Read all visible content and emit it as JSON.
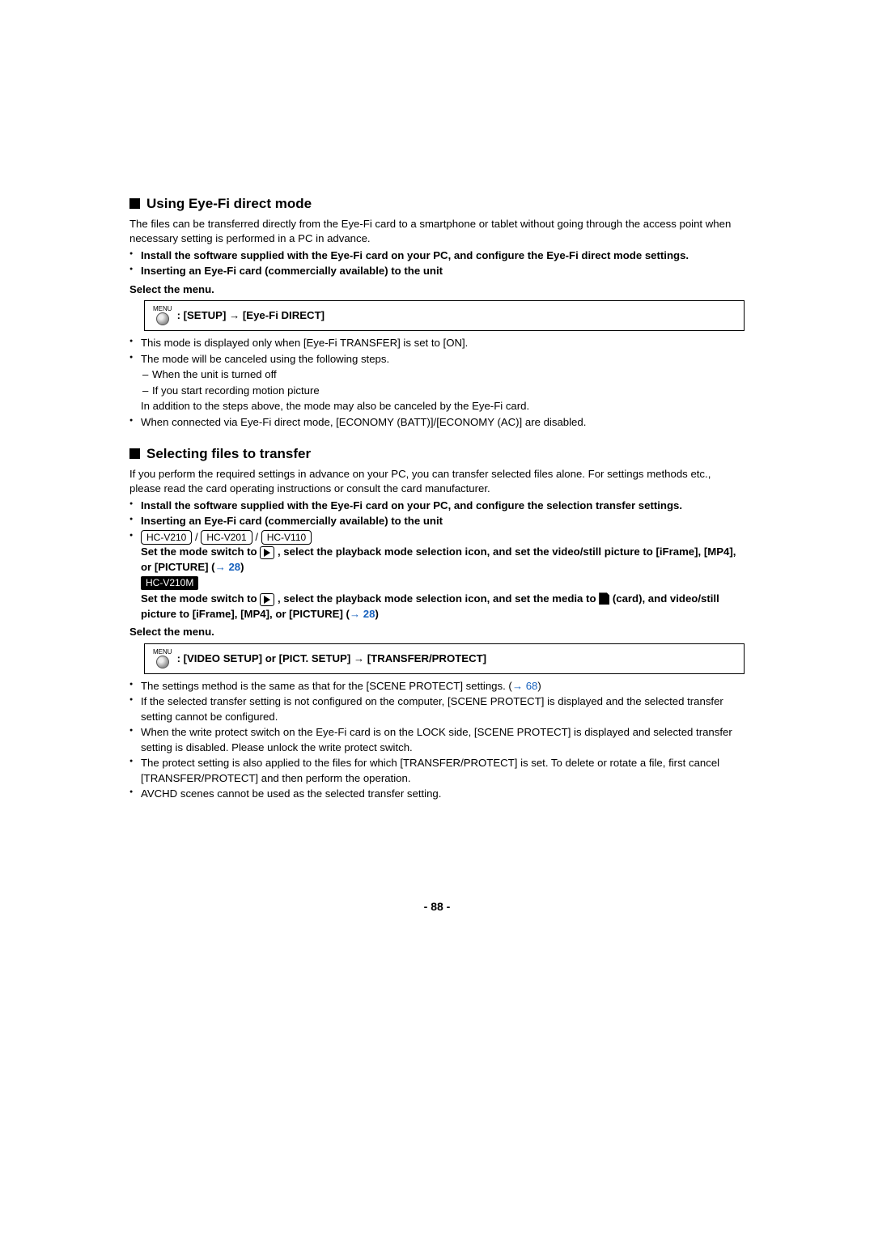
{
  "section1": {
    "heading": "Using Eye-Fi direct mode",
    "intro": "The files can be transferred directly from the Eye-Fi card to a smartphone or tablet without going through the access point when necessary setting is performed in a PC in advance.",
    "pre_bullets": [
      "Install the software supplied with the Eye-Fi card on your PC, and configure the Eye-Fi direct mode settings.",
      "Inserting an Eye-Fi card (commercially available) to the unit"
    ],
    "step_label": "Select the menu.",
    "menu_label": "MENU",
    "menu_path_a": ": [SETUP]",
    "menu_arrow": "→",
    "menu_path_b": "[Eye-Fi DIRECT]",
    "notes": [
      "This mode is displayed only when [Eye-Fi TRANSFER] is set to [ON].",
      "The mode will be canceled using the following steps."
    ],
    "subnotes": [
      "When the unit is turned off",
      "If you start recording motion picture"
    ],
    "sub_after": "In addition to the steps above, the mode may also be canceled by the Eye-Fi card.",
    "note_last": "When connected via Eye-Fi direct mode, [ECONOMY (BATT)]/[ECONOMY (AC)] are disabled."
  },
  "section2": {
    "heading": "Selecting files to transfer",
    "intro": "If you perform the required settings in advance on your PC, you can transfer selected files alone. For settings methods etc., please read the card operating instructions or consult the card manufacturer.",
    "pre_bullets_a": "Install the software supplied with the Eye-Fi card on your PC, and configure the selection transfer settings.",
    "pre_bullets_b": "Inserting an Eye-Fi card (commercially available) to the unit",
    "models": {
      "a": "HC-V210",
      "b": "HC-V201",
      "c": "HC-V110"
    },
    "item1_a": "Set the mode switch to ",
    "item1_b": " , select the playback mode selection icon, and set the video/still picture to [iFrame], [MP4], or [PICTURE] (",
    "item1_link": "28",
    "item1_c": ")",
    "model_fill": "HC-V210M",
    "item2_a": "Set the mode switch to ",
    "item2_b": " , select the playback mode selection icon, and set the media to ",
    "item2_c": " (card), and video/still picture to [iFrame], [MP4], or [PICTURE] (",
    "item2_link": "28",
    "item2_d": ")",
    "step_label": "Select the menu.",
    "menu_label": "MENU",
    "menu_path_a": ": [VIDEO SETUP] or [PICT. SETUP]",
    "menu_arrow": "→",
    "menu_path_b": "[TRANSFER/PROTECT]",
    "post1_a": "The settings method is the same as that for the [SCENE PROTECT] settings. (",
    "post1_link": "68",
    "post1_b": ")",
    "post2": "If the selected transfer setting is not configured on the computer, [SCENE PROTECT] is displayed and the selected transfer setting cannot be configured.",
    "post3": "When the write protect switch on the Eye-Fi card is on the LOCK side, [SCENE PROTECT] is displayed and selected transfer setting is disabled. Please unlock the write protect switch.",
    "post4": "The protect setting is also applied to the files for which [TRANSFER/PROTECT] is set. To delete or rotate a file, first cancel [TRANSFER/PROTECT] and then perform the operation.",
    "post5": "AVCHD scenes cannot be used as the selected transfer setting."
  },
  "page_number": "- 88 -"
}
